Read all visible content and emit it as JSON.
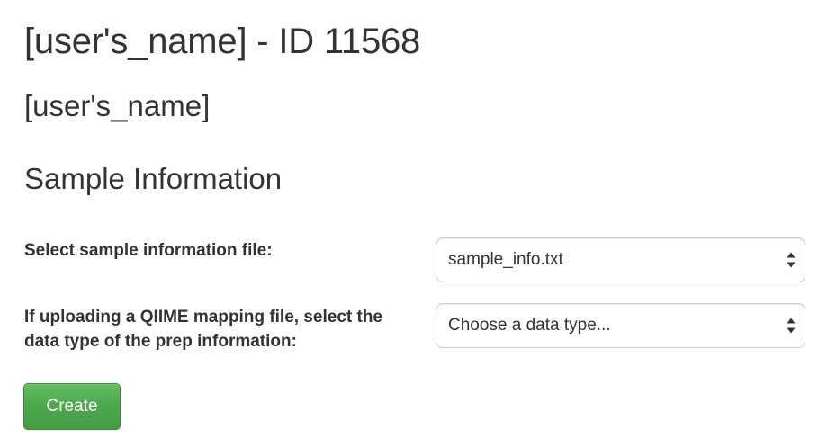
{
  "page": {
    "title": "[user's_name] - ID 11568",
    "user_name": "[user's_name]",
    "section_title": "Sample Information"
  },
  "form": {
    "sample_file": {
      "label": "Select sample information file:",
      "selected": "sample_info.txt"
    },
    "data_type": {
      "label": "If uploading a QIIME mapping file, select the data type of the prep information:",
      "placeholder": "Choose a data type..."
    },
    "create_label": "Create"
  },
  "icons": {
    "select_arrows": "up-down-chevron-icon"
  },
  "colors": {
    "text": "#333333",
    "button_green": "#4da64d",
    "button_border": "#3d8b3d",
    "input_border": "#cccccc"
  }
}
